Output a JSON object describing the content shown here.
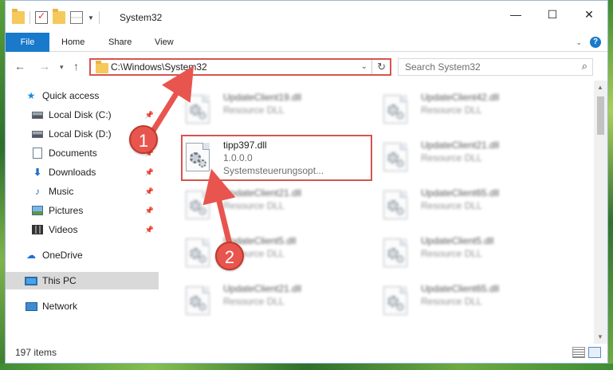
{
  "window": {
    "title": "System32",
    "controls": {
      "minimize": "—",
      "maximize": "☐",
      "close": "✕"
    }
  },
  "ribbon": {
    "tabs": [
      "File",
      "Home",
      "Share",
      "View"
    ],
    "help": "?"
  },
  "navigation": {
    "address": "C:\\Windows\\System32",
    "search_placeholder": "Search System32"
  },
  "sidebar": {
    "items": [
      {
        "label": "Quick access",
        "icon": "star-icon"
      },
      {
        "label": "Local Disk (C:)",
        "icon": "drive-icon"
      },
      {
        "label": "Local Disk (D:)",
        "icon": "drive-icon"
      },
      {
        "label": "Documents",
        "icon": "documents-icon"
      },
      {
        "label": "Downloads",
        "icon": "download-icon"
      },
      {
        "label": "Music",
        "icon": "music-icon"
      },
      {
        "label": "Pictures",
        "icon": "pictures-icon"
      },
      {
        "label": "Videos",
        "icon": "videos-icon"
      },
      {
        "label": "OneDrive",
        "icon": "cloud-icon"
      },
      {
        "label": "This PC",
        "icon": "computer-icon"
      },
      {
        "label": "Network",
        "icon": "network-icon"
      }
    ]
  },
  "files": [
    {
      "name": "UpdateClient19.dll",
      "type": "Resource DLL"
    },
    {
      "name": "UpdateClient42.dll",
      "type": "Resource DLL"
    },
    {
      "name": "tipp397.dll",
      "version": "1.0.0.0",
      "description": "Systemsteuerungsopt..."
    },
    {
      "name": "UpdateClient21.dll",
      "type": "Resource DLL"
    },
    {
      "name": "UpdateClient21.dll",
      "type": "Resource DLL"
    },
    {
      "name": "UpdateClient65.dll",
      "type": "Resource DLL"
    },
    {
      "name": "UpdateClient5.dll",
      "type": "Resource DLL"
    },
    {
      "name": "UpdateClient5.dll",
      "type": "Resource DLL"
    },
    {
      "name": "UpdateClient21.dll",
      "type": "Resource DLL"
    },
    {
      "name": "UpdateClient65.dll",
      "type": "Resource DLL"
    }
  ],
  "status": {
    "item_count": "197 items"
  },
  "callouts": {
    "one": "1",
    "two": "2"
  },
  "colors": {
    "accent": "#1979ca",
    "highlight": "#d9534f",
    "badge": "#e8554e"
  }
}
